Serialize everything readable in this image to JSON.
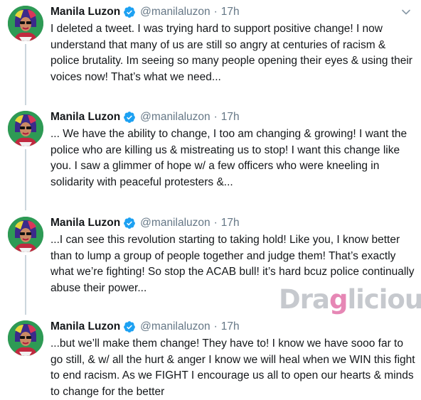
{
  "tweets": [
    {
      "name": "Manila Luzon",
      "handle": "@manilaluzon",
      "separator": "·",
      "time": "17h",
      "text": "I deleted a tweet. I was trying hard to support positive change! I now understand that many of us are still so angry at centuries of racism & police brutality. Im seeing so many people opening their eyes & using their voices now! That’s what we need..."
    },
    {
      "name": "Manila Luzon",
      "handle": "@manilaluzon",
      "separator": "·",
      "time": "17h",
      "text": "... We have the ability to change, I too am changing & growing! I want the police who are killing us & mistreating us to stop! I want this change like you. I saw a glimmer of hope w/ a few officers who were kneeling in solidarity with peaceful protesters &..."
    },
    {
      "name": "Manila Luzon",
      "handle": "@manilaluzon",
      "separator": "·",
      "time": "17h",
      "text": "...I can see this revolution starting to taking hold! Like you, I know better than to lump a group of people together and judge them! That’s exactly what we’re fighting! So stop the ACAB bull! it’s hard bcuz police continually abuse their power..."
    },
    {
      "name": "Manila Luzon",
      "handle": "@manilaluzon",
      "separator": "·",
      "time": "17h",
      "text": "...but we’ll make them change! They have to! I know we have sooo far to go still, & w/ all the hurt & anger I know we will heal when we WIN this fight to end racism. As we FIGHT I encourage us all to open our hearts & minds to change for the better"
    }
  ],
  "watermark": {
    "part1": "Dra",
    "part2": "g",
    "part3": "licious"
  },
  "icons": {
    "verified": "verified-badge-icon",
    "caret": "chevron-down-icon"
  },
  "colors": {
    "verified_blue": "#1da1f2",
    "secondary_text": "#657786",
    "thread_line": "#ccd6dd"
  }
}
